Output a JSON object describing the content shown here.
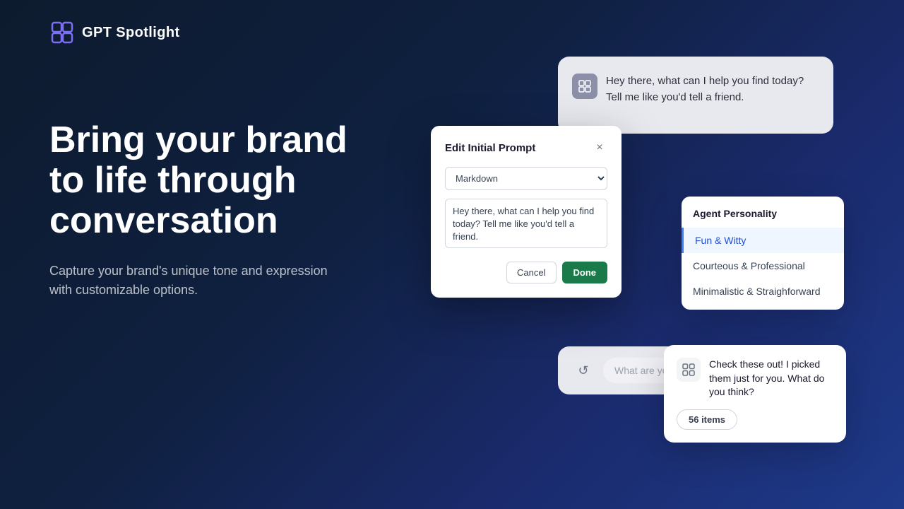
{
  "app": {
    "name": "GPT Spotlight"
  },
  "header": {
    "logo_text": "GPT Spotlight"
  },
  "left": {
    "headline": "Bring your brand\nto life through\nconversation",
    "subtext": "Capture your brand's unique tone and expression with customizable options."
  },
  "bg_chat": {
    "message": "Hey there, what can I help you find today? Tell me like you'd tell a friend.",
    "input_placeholder": "What are you"
  },
  "modal": {
    "title": "Edit Initial Prompt",
    "close_label": "×",
    "format_options": [
      "Markdown"
    ],
    "textarea_value": "Hey there, what can I help you find today? Tell me like you'd tell a friend.",
    "cancel_label": "Cancel",
    "done_label": "Done"
  },
  "personality": {
    "title": "Agent Personality",
    "items": [
      {
        "label": "Fun & Witty",
        "active": true
      },
      {
        "label": "Courteous & Professional",
        "active": false
      },
      {
        "label": "Minimalistic & Straighforward",
        "active": false
      }
    ]
  },
  "items_card": {
    "message": "Check these out! I picked them just for you. What do you think?",
    "badge": "56 items"
  },
  "icons": {
    "logo": "⧉",
    "chat_bot": "⊞",
    "refresh": "↺",
    "gear": "⚙"
  }
}
